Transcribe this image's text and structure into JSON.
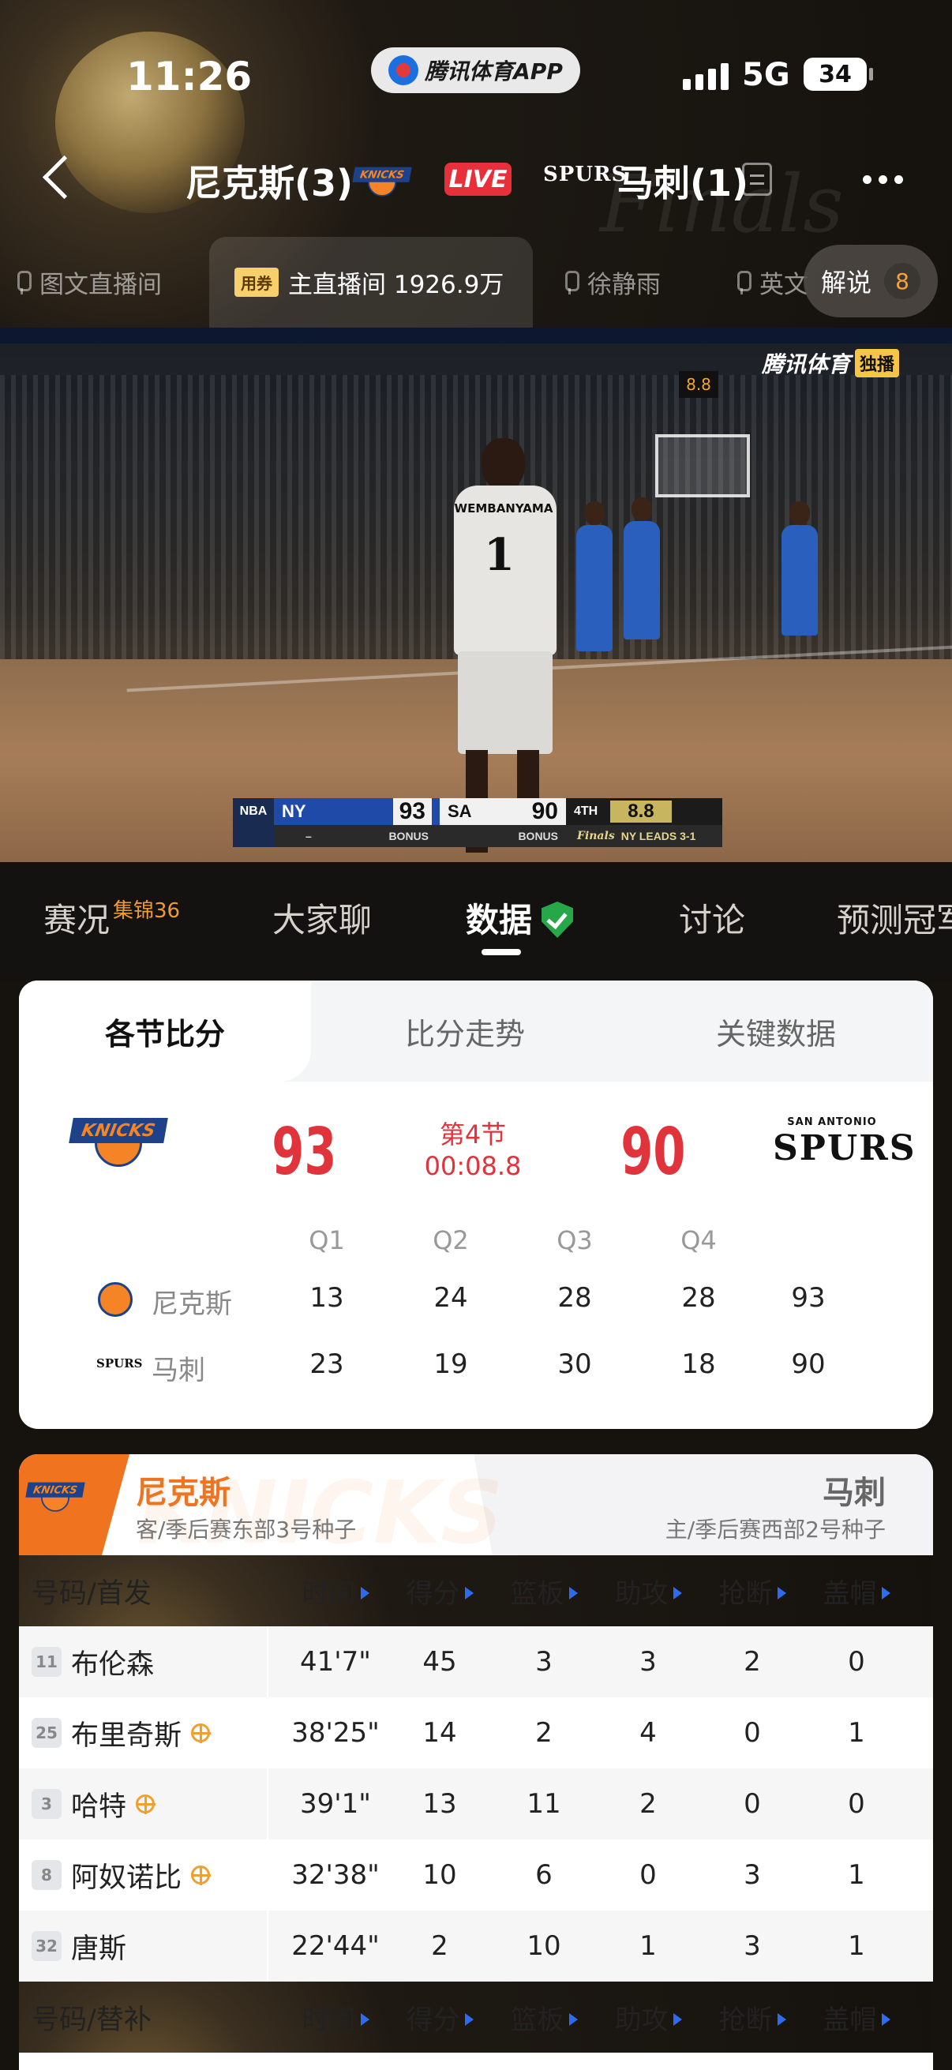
{
  "status_bar": {
    "time": "11:26",
    "network": "5G",
    "battery": "34"
  },
  "app_pill": {
    "label": "腾讯体育APP"
  },
  "match_header": {
    "team_left": "尼克斯(3)",
    "team_left_logo": "KNICKS",
    "live_label": "LIVE",
    "team_right_logo": "SPURS",
    "team_right": "马刺(1)"
  },
  "channels": {
    "items": [
      {
        "label": "图文直播间"
      },
      {
        "badge": "用券",
        "label": "主直播间 1926.9万"
      },
      {
        "label": "徐静雨"
      },
      {
        "label": "英文"
      }
    ],
    "commentary": {
      "label": "解说",
      "count": "8"
    }
  },
  "video": {
    "watermark": "腾讯体育",
    "watermark_tag": "独播",
    "player_name": "WEMBANYAMA",
    "player_number": "1",
    "shot_clock": "8.8",
    "scorebug": {
      "league": "NBA",
      "home_abbr": "NY",
      "home_score": "93",
      "away_abbr": "SA",
      "away_score": "90",
      "quarter": "4TH",
      "clock": "8.8",
      "home_bonus_dash": "–",
      "home_bonus": "BONUS",
      "away_bonus": "BONUS",
      "series_note": "NY LEADS 3-1"
    }
  },
  "tabs": {
    "items": [
      {
        "label": "赛况",
        "badge": "集锦36"
      },
      {
        "label": "大家聊"
      },
      {
        "label": "数据"
      },
      {
        "label": "讨论"
      },
      {
        "label": "预测冠军"
      }
    ],
    "active_index": 2
  },
  "score_card": {
    "tabs": [
      "各节比分",
      "比分走势",
      "关键数据"
    ],
    "home_logo": "KNICKS",
    "home_score": "93",
    "quarter_label": "第4节",
    "clock": "00:08.8",
    "away_score": "90",
    "away_logo_top": "SAN ANTONIO",
    "away_logo": "SPURS",
    "columns": [
      "Q1",
      "Q2",
      "Q3",
      "Q4"
    ],
    "rows": [
      {
        "team": "尼克斯",
        "logo": "KNICKS",
        "q": [
          "13",
          "24",
          "28",
          "28"
        ],
        "total": "93"
      },
      {
        "team": "马刺",
        "logo": "SPURS",
        "q": [
          "23",
          "19",
          "30",
          "18"
        ],
        "total": "90"
      }
    ]
  },
  "roster": {
    "bg_word": "KNICKS",
    "home_team": "尼克斯",
    "home_desc": "客/季后赛东部3号种子",
    "away_team": "马刺",
    "away_desc": "主/季后赛西部2号种子",
    "starters_header": "号码/首发",
    "bench_header": "号码/替补",
    "stat_headers": [
      "时间",
      "得分",
      "篮板",
      "助攻",
      "抢断",
      "盖帽"
    ],
    "players": [
      {
        "no": "11",
        "name": "布伦森",
        "starter_icon": false,
        "stats": [
          "41'7\"",
          "45",
          "3",
          "3",
          "2",
          "0"
        ]
      },
      {
        "no": "25",
        "name": "布里奇斯",
        "starter_icon": true,
        "stats": [
          "38'25\"",
          "14",
          "2",
          "4",
          "0",
          "1"
        ]
      },
      {
        "no": "3",
        "name": "哈特",
        "starter_icon": true,
        "stats": [
          "39'1\"",
          "13",
          "11",
          "2",
          "0",
          "0"
        ]
      },
      {
        "no": "8",
        "name": "阿奴诺比",
        "starter_icon": true,
        "stats": [
          "32'38\"",
          "10",
          "6",
          "0",
          "3",
          "1"
        ]
      },
      {
        "no": "32",
        "name": "唐斯",
        "starter_icon": false,
        "stats": [
          "22'44\"",
          "2",
          "10",
          "1",
          "3",
          "1"
        ]
      }
    ]
  }
}
